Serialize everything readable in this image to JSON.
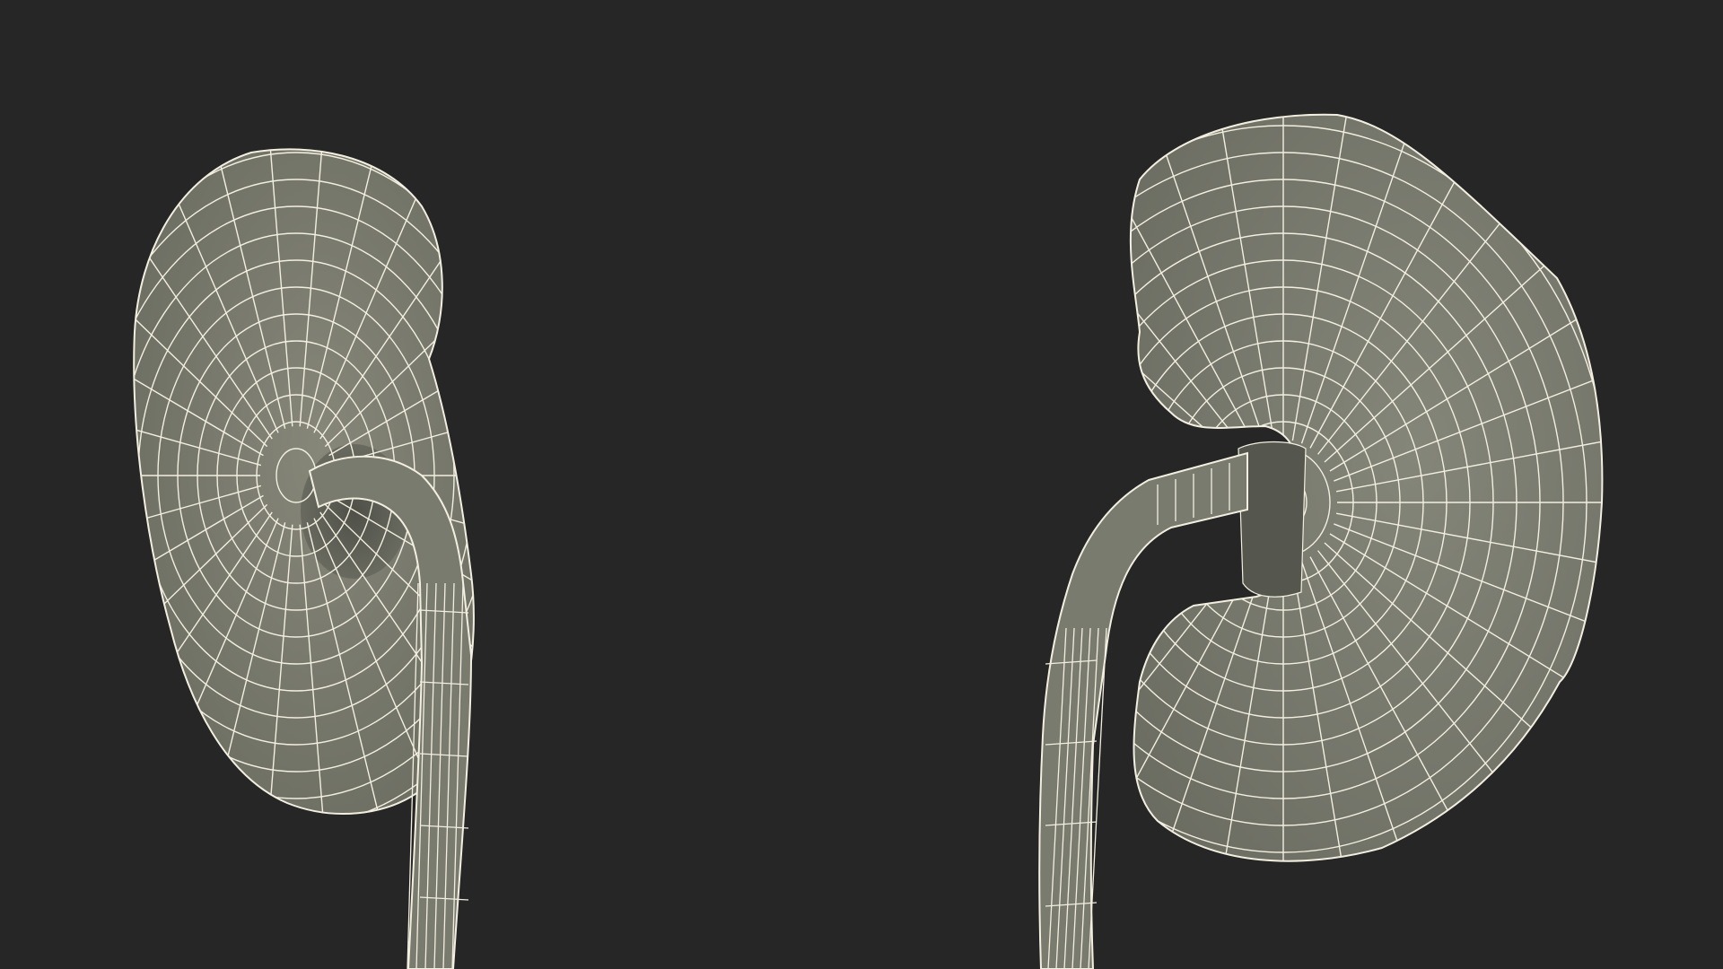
{
  "scene": {
    "subject": "two-kidney-wireframe-models",
    "colors": {
      "background": "#262626",
      "surface": "#7b7c70",
      "surface_dark": "#5c5d53",
      "wire": "#f3efe0"
    },
    "objects": [
      {
        "name": "left-kidney",
        "view": "front-three-quarter"
      },
      {
        "name": "left-ureter"
      },
      {
        "name": "right-kidney",
        "view": "side"
      },
      {
        "name": "right-ureter"
      }
    ]
  }
}
